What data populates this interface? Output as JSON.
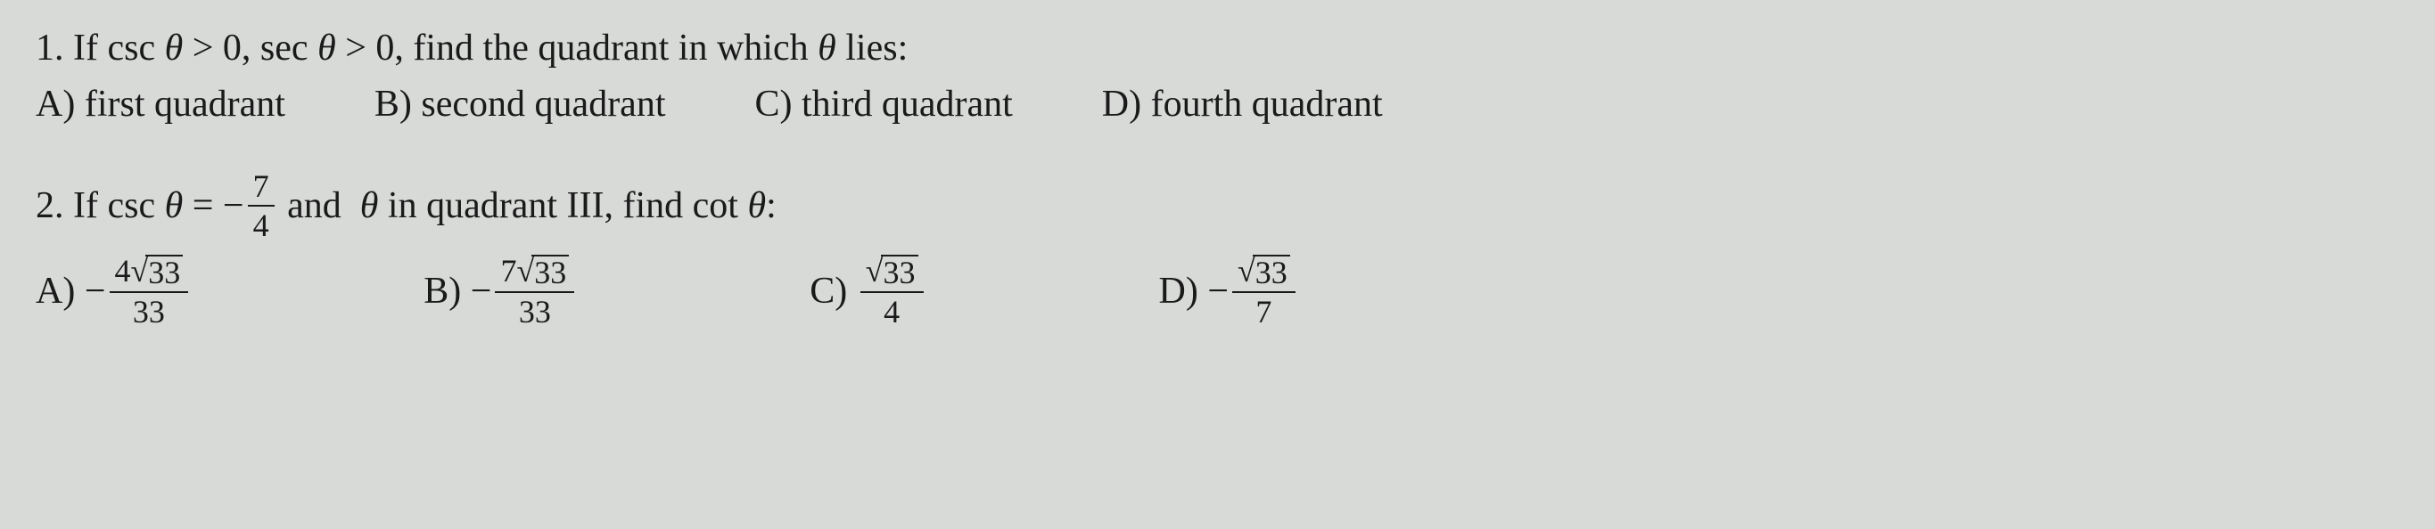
{
  "q1": {
    "number": "1.",
    "prefix": "If csc",
    "theta1": "θ",
    "gt1": "> 0, sec",
    "theta2": "θ",
    "gt2": "> 0, find the quadrant in which",
    "theta3": "θ",
    "suffix": "lies:",
    "options": {
      "a_label": "A)",
      "a_text": "first quadrant",
      "b_label": "B)",
      "b_text": "second quadrant",
      "c_label": "C)",
      "c_text": "third quadrant",
      "d_label": "D)",
      "d_text": "fourth quadrant"
    }
  },
  "q2": {
    "number": "2.",
    "prefix": "If csc",
    "theta1": "θ",
    "eq": "= −",
    "frac_num": "7",
    "frac_den": "4",
    "mid1": "and",
    "theta2": "θ",
    "mid2": "in quadrant III, find cot",
    "theta3": "θ",
    "colon": ":",
    "options": {
      "a_label": "A)",
      "a_neg": "−",
      "a_num_coef": "4",
      "a_sqrt": "√",
      "a_num_rad": "33",
      "a_den": "33",
      "b_label": "B)",
      "b_neg": "−",
      "b_num_coef": "7",
      "b_sqrt": "√",
      "b_num_rad": "33",
      "b_den": "33",
      "c_label": "C)",
      "c_sqrt": "√",
      "c_num_rad": "33",
      "c_den": "4",
      "d_label": "D)",
      "d_neg": "−",
      "d_sqrt": "√",
      "d_num_rad": "33",
      "d_den": "7"
    }
  }
}
